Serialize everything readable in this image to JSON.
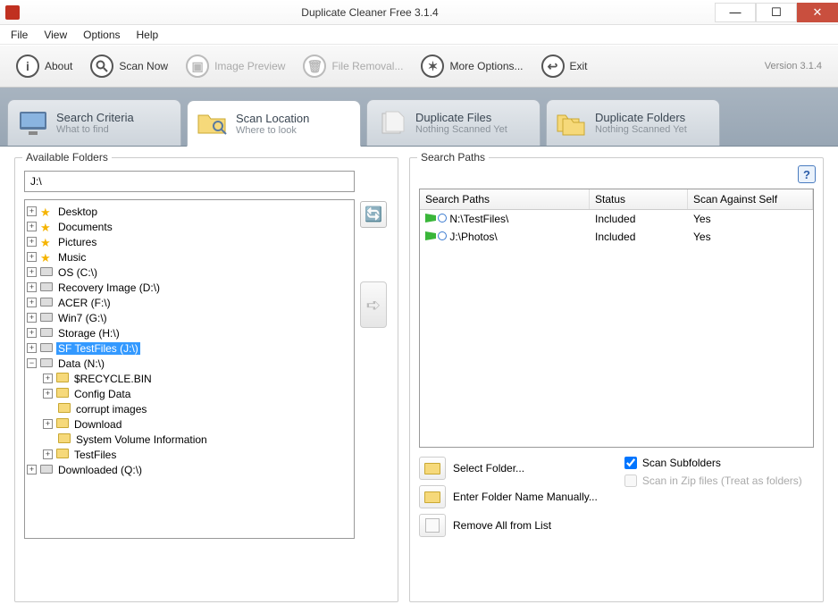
{
  "window": {
    "title": "Duplicate Cleaner Free 3.1.4"
  },
  "menu": {
    "file": "File",
    "view": "View",
    "options": "Options",
    "help": "Help"
  },
  "toolbar": {
    "about": "About",
    "scan_now": "Scan Now",
    "image_preview": "Image Preview",
    "file_removal": "File Removal...",
    "more_options": "More Options...",
    "exit": "Exit",
    "version": "Version 3.1.4"
  },
  "tabs": {
    "search_criteria": {
      "title": "Search Criteria",
      "sub": "What to find"
    },
    "scan_location": {
      "title": "Scan Location",
      "sub": "Where to look"
    },
    "duplicate_files": {
      "title": "Duplicate Files",
      "sub": "Nothing Scanned Yet"
    },
    "duplicate_folders": {
      "title": "Duplicate Folders",
      "sub": "Nothing Scanned Yet"
    }
  },
  "left_panel": {
    "legend": "Available Folders",
    "path_value": "J:\\",
    "tree": {
      "desktop": "Desktop",
      "documents": "Documents",
      "pictures": "Pictures",
      "music": "Music",
      "os": "OS (C:\\)",
      "recovery": "Recovery Image (D:\\)",
      "acer": "ACER (F:\\)",
      "win7": "Win7 (G:\\)",
      "storage": "Storage (H:\\)",
      "sftest": "SF TestFiles (J:\\)",
      "data": "Data (N:\\)",
      "recycle": "$RECYCLE.BIN",
      "config": "Config Data",
      "corrupt": "corrupt images",
      "download": "Download",
      "sysvol": "System Volume Information",
      "testfiles": "TestFiles",
      "downloaded": "Downloaded (Q:\\)"
    }
  },
  "right_panel": {
    "legend": "Search Paths",
    "columns": {
      "path": "Search Paths",
      "status": "Status",
      "self": "Scan Against Self"
    },
    "rows": [
      {
        "path": "N:\\TestFiles\\",
        "status": "Included",
        "self": "Yes"
      },
      {
        "path": "J:\\Photos\\",
        "status": "Included",
        "self": "Yes"
      }
    ],
    "actions": {
      "select_folder": "Select Folder...",
      "enter_manual": "Enter Folder Name Manually...",
      "remove_all": "Remove All from List",
      "scan_subfolders": "Scan Subfolders",
      "scan_zip": "Scan in Zip files (Treat as folders)"
    }
  }
}
